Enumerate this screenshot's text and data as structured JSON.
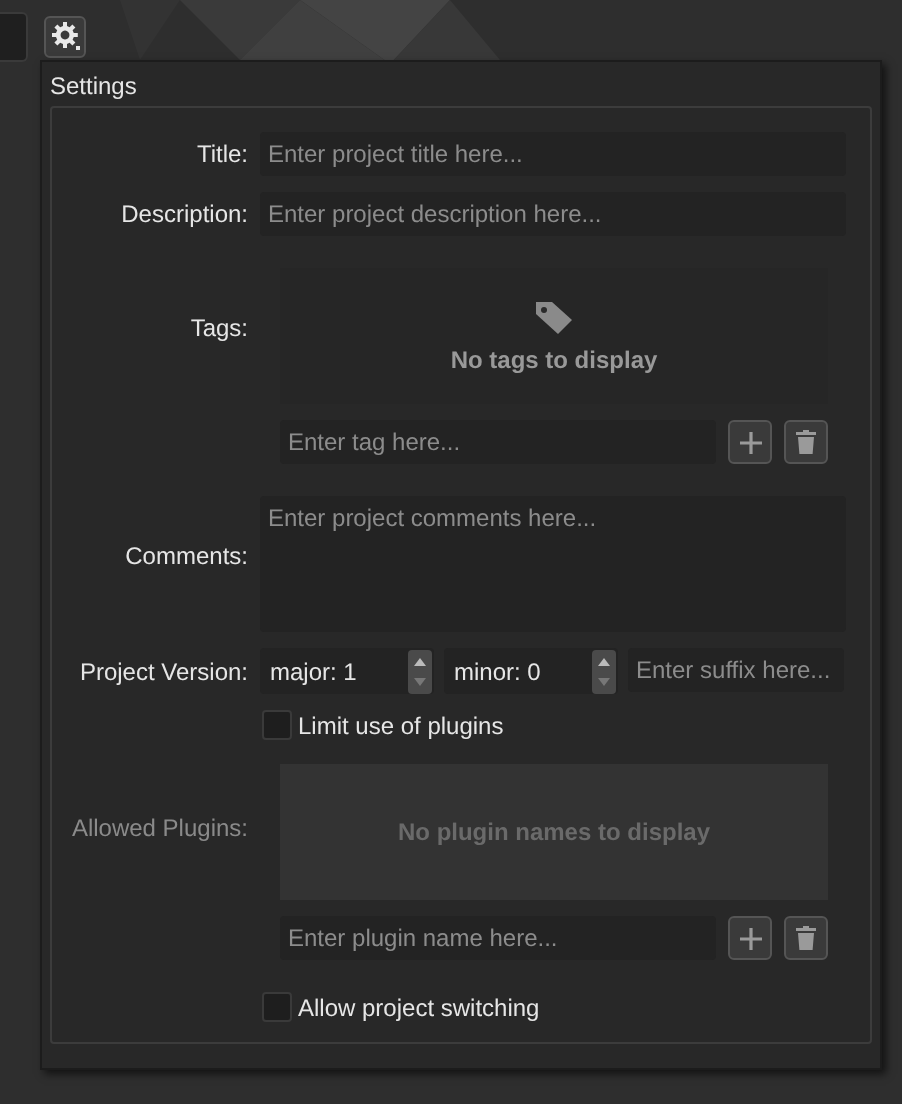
{
  "header": {
    "title": "Settings"
  },
  "title_field": {
    "label": "Title:",
    "placeholder": "Enter project title here..."
  },
  "description_field": {
    "label": "Description:",
    "placeholder": "Enter project description here..."
  },
  "tags": {
    "label": "Tags:",
    "empty_text": "No tags to display",
    "input_placeholder": "Enter tag here..."
  },
  "comments": {
    "label": "Comments:",
    "placeholder": "Enter project comments here..."
  },
  "version": {
    "label": "Project Version:",
    "major": "major: 1",
    "minor": "minor: 0",
    "suffix_placeholder": "Enter suffix here..."
  },
  "limit_plugins": {
    "label": "Limit use of plugins",
    "checked": false
  },
  "plugins": {
    "label": "Allowed Plugins:",
    "disabled": true,
    "empty_text": "No plugin names to display",
    "input_placeholder": "Enter plugin name here..."
  },
  "allow_switching": {
    "label": "Allow project switching",
    "checked": false
  }
}
